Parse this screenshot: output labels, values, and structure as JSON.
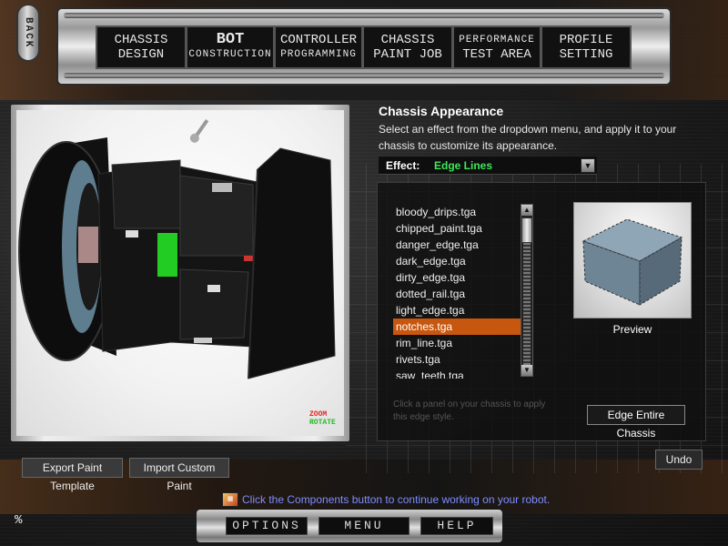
{
  "back_label": "BACK",
  "nav": [
    {
      "line1": "CHASSIS",
      "line2": "DESIGN"
    },
    {
      "line1": "BOT",
      "line2": "CONSTRUCTION"
    },
    {
      "line1": "CONTROLLER",
      "line2": "PROGRAMMING"
    },
    {
      "line1": "CHASSIS",
      "line2": "PAINT JOB"
    },
    {
      "line1": "PERFORMANCE",
      "line2": "TEST AREA"
    },
    {
      "line1": "PROFILE",
      "line2": "SETTING"
    }
  ],
  "viewport": {
    "zoom_label": "ZOOM",
    "rotate_label": "ROTATE"
  },
  "appearance": {
    "title": "Chassis Appearance",
    "description": "Select an effect from the dropdown menu, and apply it to your chassis to customize its appearance.",
    "effect_label": "Effect:",
    "effect_value": "Edge Lines"
  },
  "textures": [
    "bloody_drips.tga",
    "chipped_paint.tga",
    "danger_edge.tga",
    "dark_edge.tga",
    "dirty_edge.tga",
    "dotted_rail.tga",
    "light_edge.tga",
    "notches.tga",
    "rim_line.tga",
    "rivets.tga",
    "saw_teeth.tga"
  ],
  "selected_texture": "notches.tga",
  "preview_label": "Preview",
  "hint": "Click a panel on your chassis to apply this edge style.",
  "buttons": {
    "edge_entire": "Edge Entire Chassis",
    "undo": "Undo",
    "export": "Export Paint Template",
    "import": "Import Custom Paint"
  },
  "status_text": "Click the Components button to continue working on your robot.",
  "bottom": {
    "options": "OPTIONS",
    "menu": "MENU",
    "help": "HELP"
  },
  "colors": {
    "accent_selected": "#c7560f",
    "effect_value": "#3ee75a",
    "status_link": "#7f8cff"
  }
}
